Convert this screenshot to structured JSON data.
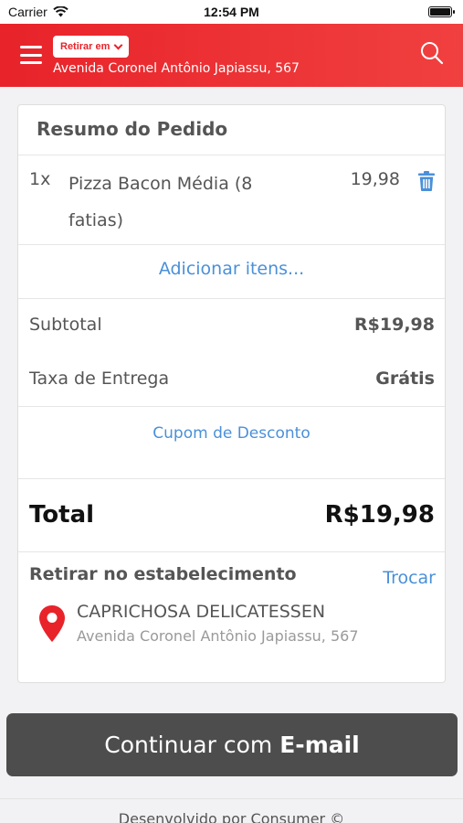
{
  "status_bar": {
    "carrier": "Carrier",
    "time": "12:54 PM"
  },
  "header": {
    "mode_label": "Retirar em",
    "address": "Avenida Coronel Antônio Japiassu, 567",
    "brand_color": "#e8232a",
    "icons": [
      "hamburger-icon",
      "chevron-down-icon",
      "search-icon"
    ]
  },
  "order_summary": {
    "title": "Resumo do Pedido",
    "items": [
      {
        "qty": "1x",
        "name": "Pizza Bacon Média (8 fatias)",
        "price": "19,98",
        "icon": "trash-icon"
      }
    ],
    "add_items_label": "Adicionar itens...",
    "subtotal_label": "Subtotal",
    "subtotal_value": "R$19,98",
    "delivery_fee_label": "Taxa de Entrega",
    "delivery_fee_value": "Grátis",
    "coupon_label": "Cupom de Desconto",
    "total_label": "Total",
    "total_value": "R$19,98",
    "link_color": "#4a90d9"
  },
  "pickup": {
    "title": "Retirar no estabelecimento",
    "change_label": "Trocar",
    "store_name": "CAPRICHOSA DELICATESSEN",
    "store_address": "Avenida Coronel Antônio Japiassu, 567",
    "icon": "location-pin-icon"
  },
  "continue_button": {
    "prefix": "Continuar com",
    "method": "E-mail",
    "color": "#4d4d4d"
  },
  "footer": {
    "text": "Desenvolvido por Consumer ©"
  }
}
